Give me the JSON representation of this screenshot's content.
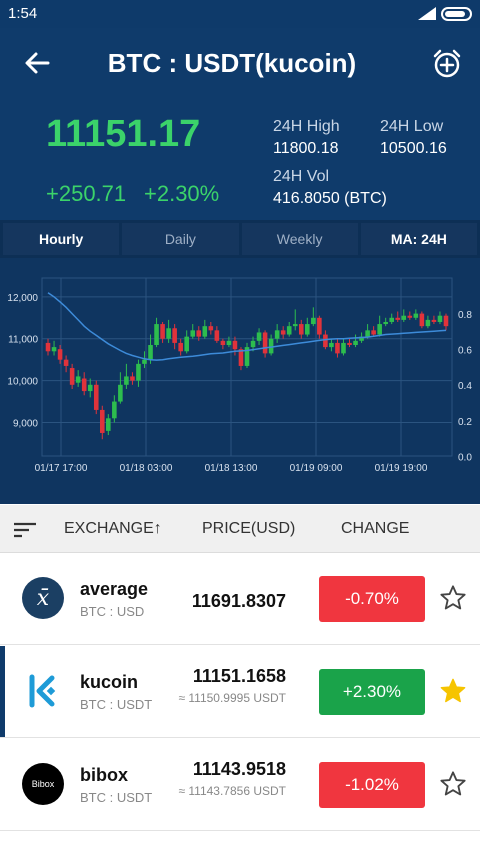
{
  "status_bar": {
    "time": "1:54"
  },
  "header": {
    "title": "BTC : USDT(kucoin)",
    "last_price": "11151.17",
    "change_abs": "+250.71",
    "change_pct": "+2.30%",
    "high_label": "24H High",
    "high_value": "11800.18",
    "low_label": "24H Low",
    "low_value": "10500.16",
    "vol_label": "24H Vol",
    "vol_value": "416.8050 (BTC)"
  },
  "tabs": [
    {
      "label": "Hourly",
      "active": true
    },
    {
      "label": "Daily",
      "active": false
    },
    {
      "label": "Weekly",
      "active": false
    },
    {
      "label": "MA: 24H",
      "active": false
    }
  ],
  "chart_data": {
    "type": "candlestick",
    "y_left_ticks": [
      "12,000",
      "11,000",
      "10,000",
      "9,000"
    ],
    "y_right_ticks": [
      "0.8",
      "0.6",
      "0.4",
      "0.2",
      "0.0"
    ],
    "x_ticks": [
      "01/17 17:00",
      "01/18 03:00",
      "01/18 13:00",
      "01/19 09:00",
      "01/19 19:00"
    ],
    "ylim": [
      8200,
      12450
    ],
    "series": [
      {
        "name": "MA",
        "color": "#3d8bd9"
      }
    ],
    "colors": {
      "up": "#2dbd4e",
      "down": "#e0333b"
    }
  },
  "list": {
    "header": {
      "exchange": "EXCHANGE↑",
      "price": "PRICE(USD)",
      "change": "CHANGE"
    },
    "rows": [
      {
        "name": "average",
        "pair": "BTC : USD",
        "price": "11691.8307",
        "sub": "",
        "change": "-0.70%",
        "direction": "down",
        "starred": false,
        "logo": "x̄"
      },
      {
        "name": "kucoin",
        "pair": "BTC : USDT",
        "price": "11151.1658",
        "sub": "≈ 11150.9995 USDT",
        "change": "+2.30%",
        "direction": "up",
        "starred": true,
        "logo": "K"
      },
      {
        "name": "bibox",
        "pair": "BTC : USDT",
        "price": "11143.9518",
        "sub": "≈ 11143.7856 USDT",
        "change": "-1.02%",
        "direction": "down",
        "starred": false,
        "logo": "Bibox"
      }
    ]
  }
}
